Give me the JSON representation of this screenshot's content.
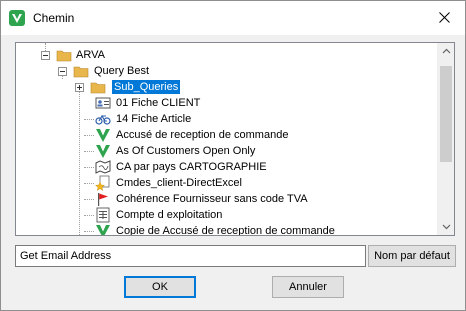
{
  "window": {
    "title": "Chemin",
    "close_icon": "close-icon",
    "app_icon": "app-checkmark-icon"
  },
  "tree": {
    "items": [
      {
        "label": "ARVA",
        "icon": "folder-icon",
        "expanded": true,
        "level": 1
      },
      {
        "label": "Query Best",
        "icon": "folder-icon",
        "expanded": true,
        "level": 2
      },
      {
        "label": "Sub_Queries",
        "icon": "folder-icon",
        "expanded": false,
        "selected": true,
        "level": 3
      },
      {
        "label": "01 Fiche CLIENT",
        "icon": "contact-card-icon",
        "level": 3
      },
      {
        "label": "14 Fiche Article",
        "icon": "bicycle-icon",
        "level": 3
      },
      {
        "label": "Accusé de reception de commande",
        "icon": "green-check-icon",
        "level": 3
      },
      {
        "label": "As Of Customers Open Only",
        "icon": "green-check-icon",
        "level": 3
      },
      {
        "label": "CA par pays CARTOGRAPHIE",
        "icon": "map-icon",
        "level": 3
      },
      {
        "label": "Cmdes_client-DirectExcel",
        "icon": "star-document-icon",
        "level": 3
      },
      {
        "label": "Cohérence Fournisseur sans code TVA",
        "icon": "red-flag-icon",
        "level": 3
      },
      {
        "label": "Compte d exploitation",
        "icon": "spreadsheet-icon",
        "level": 3
      },
      {
        "label": "Copie de Accusé de reception de commande",
        "icon": "green-check-icon",
        "level": 3
      }
    ]
  },
  "form": {
    "name_value": "Get Email Address",
    "default_name_label": "Nom par défaut",
    "ok_label": "OK",
    "cancel_label": "Annuler"
  },
  "colors": {
    "selection": "#0078d7",
    "folder": "#e8b64a",
    "check": "#2ea44f"
  }
}
